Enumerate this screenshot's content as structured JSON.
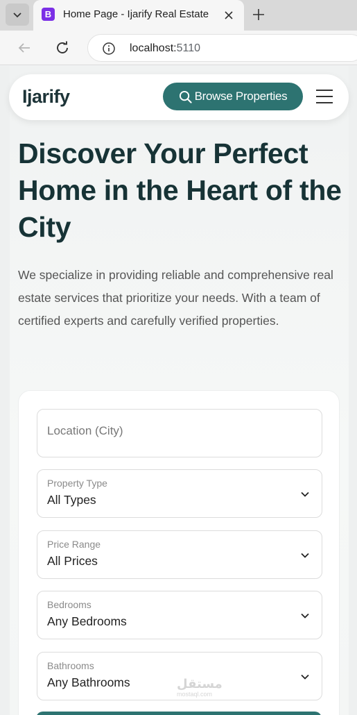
{
  "browser": {
    "tab_title": "Home Page - Ijarify Real Estate",
    "favicon_letter": "B",
    "url_host": "localhost:",
    "url_port": "5110"
  },
  "navbar": {
    "logo": "Ijarify",
    "browse_label": "Browse Properties"
  },
  "hero": {
    "title": "Discover Your Perfect Home in the Heart of the City",
    "description": "We specialize in providing reliable and comprehensive real estate services that prioritize your needs. With a team of certified experts and carefully verified properties."
  },
  "search": {
    "location_placeholder": "Location (City)",
    "fields": [
      {
        "label": "Property Type",
        "value": "All Types"
      },
      {
        "label": "Price Range",
        "value": "All Prices"
      },
      {
        "label": "Bedrooms",
        "value": "Any Bedrooms"
      },
      {
        "label": "Bathrooms",
        "value": "Any Bathrooms"
      }
    ]
  },
  "watermark": {
    "main": "مستقل",
    "sub": "mostaql.com"
  },
  "colors": {
    "accent": "#2d7371",
    "heading": "#173336",
    "favicon": "#7b2fe6"
  }
}
